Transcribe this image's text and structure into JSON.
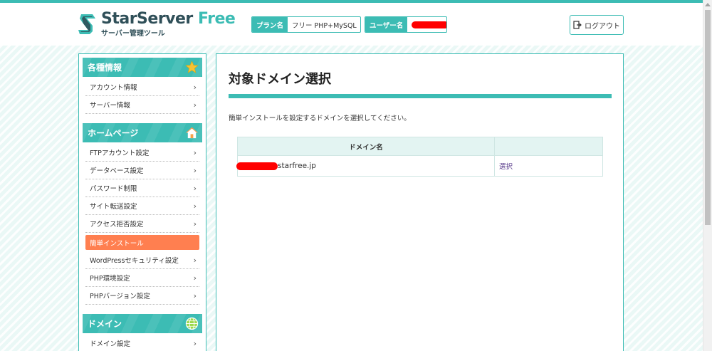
{
  "header": {
    "logo_title": "StarServer",
    "logo_title_free": "Free",
    "logo_subtitle": "サーバー管理ツール",
    "plan_label": "プラン名",
    "plan_value": "フリー PHP+MySQL",
    "user_label": "ユーザー名",
    "logout_label": "ログアウト"
  },
  "sidebar": {
    "sections": [
      {
        "title": "各種情報",
        "icon": "star-icon",
        "items": [
          {
            "label": "アカウント情報"
          },
          {
            "label": "サーバー情報"
          }
        ]
      },
      {
        "title": "ホームページ",
        "icon": "house-icon",
        "items": [
          {
            "label": "FTPアカウント設定"
          },
          {
            "label": "データベース設定"
          },
          {
            "label": "パスワード制限"
          },
          {
            "label": "サイト転送設定"
          },
          {
            "label": "アクセス拒否設定"
          },
          {
            "label": "簡単インストール",
            "active": true
          },
          {
            "label": "WordPressセキュリティ設定"
          },
          {
            "label": "PHP環境設定"
          },
          {
            "label": "PHPバージョン設定"
          }
        ]
      },
      {
        "title": "ドメイン",
        "icon": "globe-icon",
        "items": [
          {
            "label": "ドメイン設定"
          }
        ]
      }
    ],
    "chevron": "›"
  },
  "main": {
    "title": "対象ドメイン選択",
    "description": "簡単インストールを設定するドメインを選択してください。",
    "table": {
      "columns": [
        "ドメイン名",
        ""
      ],
      "rows": [
        {
          "domain_suffix": "starfree.jp",
          "action": "選択"
        }
      ]
    }
  },
  "colors": {
    "accent": "#3cbcb4",
    "active_item": "#ff7f50",
    "redaction": "#ff0000"
  }
}
